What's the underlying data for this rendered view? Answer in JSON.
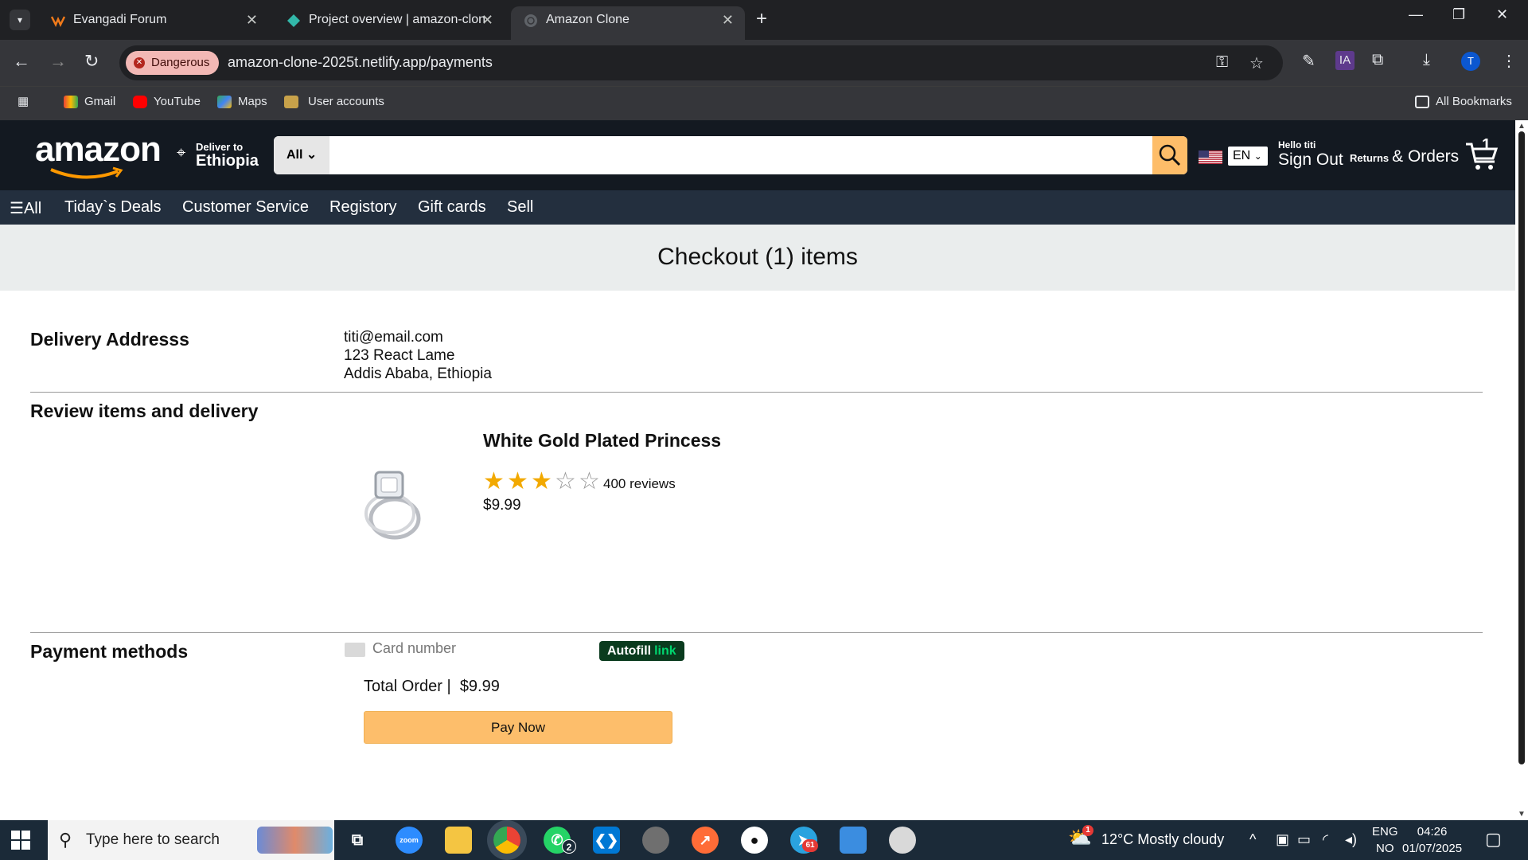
{
  "browser": {
    "tabs": [
      {
        "title": "Evangadi Forum",
        "favicon": "evangadi-icon"
      },
      {
        "title": "Project overview | amazon-clon",
        "favicon": "netlify-icon"
      },
      {
        "title": "Amazon Clone",
        "favicon": "globe-icon",
        "active": true
      }
    ],
    "security_badge": "Dangerous",
    "url": "amazon-clone-2025t.netlify.app/payments",
    "profile_initial": "T",
    "extension_label": "IA",
    "bookmarks": [
      "Gmail",
      "YouTube",
      "Maps",
      "User accounts"
    ],
    "all_bookmarks": "All Bookmarks"
  },
  "header": {
    "logo": "amazon",
    "deliver_small": "Deliver to",
    "deliver_country": "Ethiopia",
    "search_category": "All",
    "search_placeholder": "",
    "language": "EN",
    "hello": "Hello titi",
    "sign_out": "Sign Out",
    "returns": "Returns",
    "orders": "& Orders",
    "cart_count": "1"
  },
  "subnav": {
    "all": "All",
    "items": [
      "Tiday`s Deals",
      "Customer Service",
      "Registory",
      "Gift cards",
      "Sell"
    ]
  },
  "checkout": {
    "title": "Checkout (1) items",
    "delivery_title": "Delivery Addresss",
    "address": [
      "titi@email.com",
      "123 React Lame",
      "Addis Ababa, Ethiopia"
    ],
    "review_title": "Review items and delivery",
    "product": {
      "title": "White Gold Plated Princess",
      "rating": 3,
      "rating_max": 5,
      "reviews": "400 reviews",
      "price": "$9.99"
    },
    "payment_title": "Payment methods",
    "card_placeholder": "Card number",
    "autofill": "Autofill",
    "autofill_link": "link",
    "total_label": "Total Order |",
    "total_value": "$9.99",
    "pay_button": "Pay Now"
  },
  "taskbar": {
    "search_placeholder": "Type here to search",
    "apps": [
      "task-view",
      "zoom",
      "file-explorer",
      "chrome",
      "whatsapp",
      "vscode",
      "github-desktop",
      "postman",
      "github",
      "telegram",
      "paint",
      "snipping-tool"
    ],
    "whatsapp_badge": "2",
    "telegram_badge": "61",
    "weather": "12°C  Mostly cloudy",
    "weather_badge": "1",
    "lang_top": "ENG",
    "lang_bottom": "NO",
    "time": "04:26",
    "date": "01/07/2025"
  },
  "colors": {
    "header_bg": "#131921",
    "subnav_bg": "#232f3e",
    "accent": "#febd69",
    "star": "#f2a900"
  }
}
